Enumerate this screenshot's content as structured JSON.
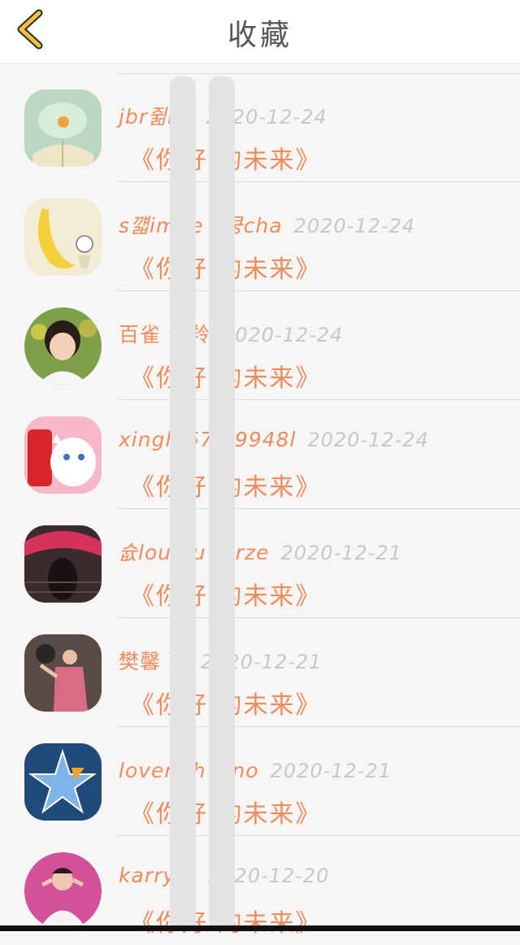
{
  "header": {
    "title": "收藏",
    "back_icon": "chevron-left-icon",
    "accent_color": "#f0c23a"
  },
  "items": [
    {
      "name": "jbr쥚ne",
      "date": "2020-12-24",
      "work": "《你好 的未来》"
    },
    {
      "name": "s꺫imne o쿵cha",
      "date": "2020-12-24",
      "work": "《你好 的未来》"
    },
    {
      "name": "百雀   合羚",
      "date": "2020-12-24",
      "work": "《你好 的未来》"
    },
    {
      "name": "xingh 57 79948l",
      "date": "2020-12-24",
      "work": "《你好 的未来》"
    },
    {
      "name": "슚lou qu torze",
      "date": "2020-12-21",
      "work": "《你好 的未来》"
    },
    {
      "name": "樊馨   蔓",
      "date": "2020-12-21",
      "work": "《你好 的未来》"
    },
    {
      "name": "lovem  h멦ino",
      "date": "2020-12-21",
      "work": "《你好 的未来》"
    },
    {
      "name": "karry 2",
      "date": "2020-12-20",
      "work": "《你好 的未来》"
    }
  ],
  "colors": {
    "accent": "#ef8b5c",
    "date": "#c8c8c8",
    "background": "#f8f5f5"
  }
}
